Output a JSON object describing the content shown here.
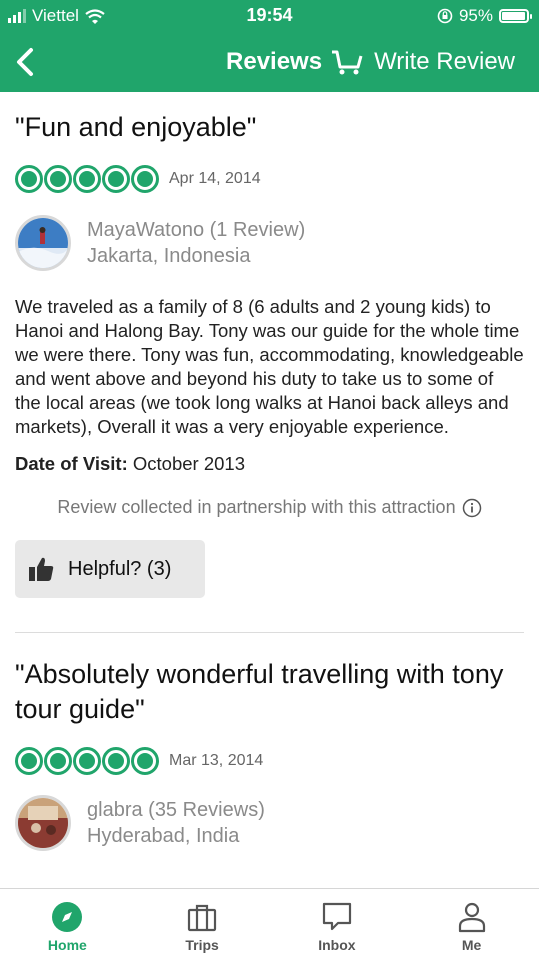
{
  "status_bar": {
    "carrier": "Viettel",
    "time": "19:54",
    "battery": "95%"
  },
  "nav": {
    "title": "Reviews",
    "write_review": "Write Review"
  },
  "reviews": [
    {
      "title": "\"Fun and enjoyable\"",
      "rating": 5,
      "date": "Apr 14, 2014",
      "user": "MayaWatono (1 Review)",
      "location": "Jakarta, Indonesia",
      "body": "We traveled as a family of 8 (6 adults and 2 young kids) to Hanoi and Halong Bay. Tony was our guide for the whole time we were there. Tony was fun, accommodating, knowledgeable and went above and beyond his duty to take us to some of the local areas (we took long walks at Hanoi back alleys and markets), Overall it was a very enjoyable experience.",
      "visit_label": "Date of Visit:",
      "visit_value": "October 2013",
      "partner_note": "Review collected in partnership with this attraction",
      "helpful": "Helpful? (3)"
    },
    {
      "title": "\"Absolutely wonderful travelling with tony tour guide\"",
      "rating": 5,
      "date": "Mar 13, 2014",
      "user": "glabra (35 Reviews)",
      "location": "Hyderabad, India"
    }
  ],
  "tabs": [
    {
      "label": "Home",
      "icon": "compass-icon",
      "active": true
    },
    {
      "label": "Trips",
      "icon": "suitcase-icon",
      "active": false
    },
    {
      "label": "Inbox",
      "icon": "chat-icon",
      "active": false
    },
    {
      "label": "Me",
      "icon": "person-icon",
      "active": false
    }
  ],
  "colors": {
    "brand": "#20a56b"
  }
}
